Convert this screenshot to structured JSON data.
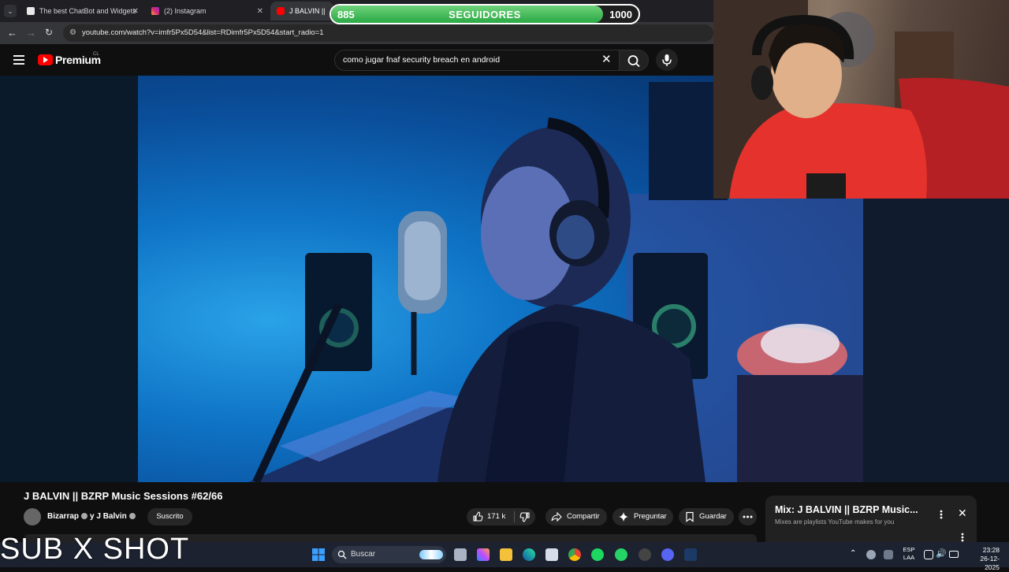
{
  "browser": {
    "tabs": [
      {
        "title": "The best ChatBot and Widgets",
        "active": false
      },
      {
        "title": "(2) Instagram",
        "active": false
      },
      {
        "title": "J BALVIN || BZR",
        "active": true
      }
    ],
    "url": "youtube.com/watch?v=imfr5Px5D54&list=RDimfr5Px5D54&start_radio=1"
  },
  "overlay": {
    "follower_current": "885",
    "follower_label": "SEGUIDORES",
    "follower_goal": "1000",
    "follower_progress": 0.885,
    "caption": "SUB X SHOT"
  },
  "youtube": {
    "logo_text": "Premium",
    "country_code": "CL",
    "search_query": "como jugar fnaf security breach en android"
  },
  "video": {
    "title": "J BALVIN || BZRP Music Sessions #62/66",
    "channel_name": "Bizarrap",
    "channel_joiner": "y J Balvin",
    "subscribed_label": "Suscrito",
    "likes": "171 k",
    "share_label": "Compartir",
    "ask_label": "Preguntar",
    "save_label": "Guardar"
  },
  "mix": {
    "title": "Mix: J BALVIN || BZRP Music...",
    "subtitle": "Mixes are playlists YouTube makes for you"
  },
  "taskbar": {
    "search_placeholder": "Buscar",
    "lang_top": "ESP",
    "lang_bottom": "LAA",
    "time": "23:28",
    "date": "26-12-2025"
  },
  "colors": {
    "follower_fill": "#2aa844",
    "youtube_red": "#ff0000",
    "video_blue": "#0f74c6"
  }
}
